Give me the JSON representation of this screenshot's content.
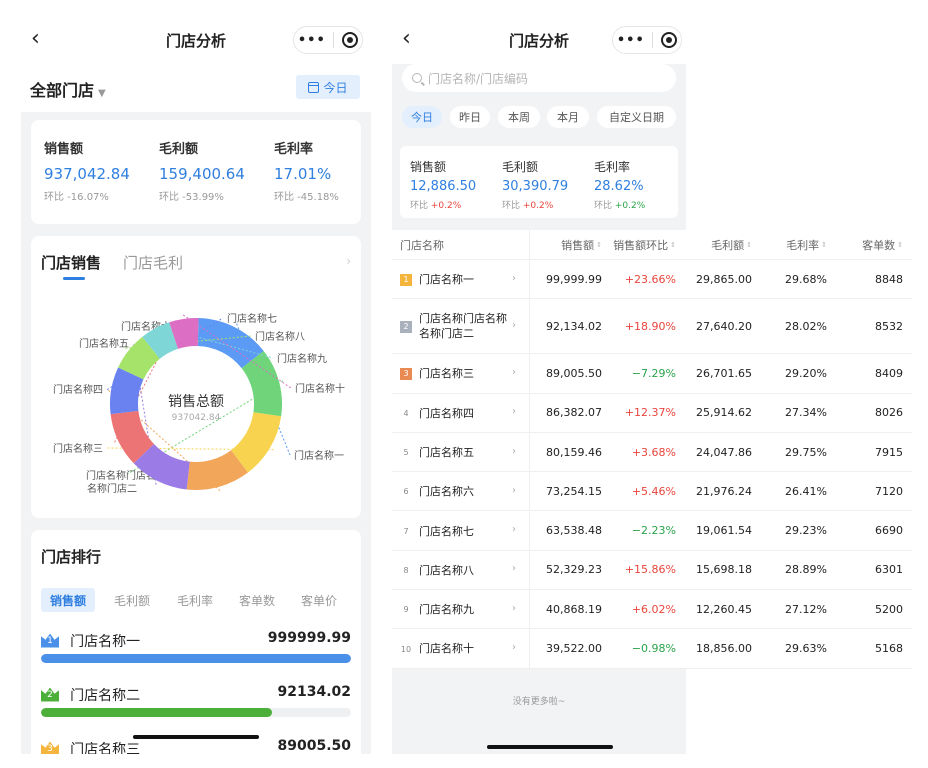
{
  "colors": {
    "accent": "#2f7fe0",
    "up": "#e8453c",
    "down": "#2aa34a",
    "bg": "#f2f3f5"
  },
  "left": {
    "nav": {
      "title": "门店分析",
      "back_icon": "chevron-left-icon",
      "more_icon": "more-dots-icon",
      "target_icon": "target-icon"
    },
    "store_selector": "全部门店",
    "date_button": "今日",
    "metrics": [
      {
        "label": "销售额",
        "value": "937,042.84",
        "compare": "环比 -16.07%"
      },
      {
        "label": "毛利额",
        "value": "159,400.64",
        "compare": "环比 -53.99%"
      },
      {
        "label": "毛利率",
        "value": "17.01%",
        "compare": "环比 -45.18%"
      }
    ],
    "sales_card": {
      "tab_active": "门店销售",
      "tab_inactive": "门店毛利",
      "arrow": "›"
    },
    "chart_data": {
      "type": "pie",
      "center_title": "销售总额",
      "center_value": "937042.84",
      "slices": [
        {
          "name": "门店名称一",
          "value": 99999.99,
          "color": "#5b9bf5"
        },
        {
          "name": "门店名称门店名称名称门店二",
          "value": 92134.02,
          "color": "#6fd47a"
        },
        {
          "name": "门店名称三",
          "value": 89005.5,
          "color": "#f7d34f"
        },
        {
          "name": "门店名称四",
          "value": 86382.07,
          "color": "#f2a65a"
        },
        {
          "name": "门店名称五",
          "value": 80159.46,
          "color": "#9b7be6"
        },
        {
          "name": "门店名称六",
          "value": 73254.15,
          "color": "#ec7474"
        },
        {
          "name": "门店名称七",
          "value": 63538.48,
          "color": "#6a82f0"
        },
        {
          "name": "门店名称八",
          "value": 52329.23,
          "color": "#a5e36a"
        },
        {
          "name": "门店名称九",
          "value": 40868.19,
          "color": "#7fd6d6"
        },
        {
          "name": "门店名称十",
          "value": 39522.0,
          "color": "#dc6ec4"
        }
      ]
    },
    "ranking": {
      "title": "门店排行",
      "tabs": [
        "销售额",
        "毛利额",
        "毛利率",
        "客单数",
        "客单价"
      ],
      "rows": [
        {
          "rank": "1",
          "name": "门店名称一",
          "value": "999999.99",
          "fraction": 1.0,
          "color": "#4a90e8",
          "crown": "#4a90e8"
        },
        {
          "rank": "2",
          "name": "门店名称二",
          "value": "92134.02",
          "fraction": 0.745,
          "color": "#4caf3a",
          "crown": "#4caf3a"
        },
        {
          "rank": "3",
          "name": "门店名称三",
          "value": "89005.50",
          "fraction": 0.72,
          "color": "#f3b53c",
          "crown": "#f3b53c"
        }
      ]
    }
  },
  "right": {
    "nav": {
      "title": "门店分析",
      "back_icon": "chevron-left-icon"
    },
    "search_placeholder": "门店名称/门店编码",
    "date_chips": [
      "今日",
      "昨日",
      "本周",
      "本月",
      "自定义日期"
    ],
    "metrics": [
      {
        "label": "销售额",
        "value": "12,886.50",
        "compare_label": "环比",
        "compare": "+0.2%",
        "dir": "up"
      },
      {
        "label": "毛利额",
        "value": "30,390.79",
        "compare_label": "环比",
        "compare": "+0.2%",
        "dir": "up"
      },
      {
        "label": "毛利率",
        "value": "28.62%",
        "compare_label": "环比",
        "compare": "+0.2%",
        "dir": "down"
      }
    ],
    "table": {
      "headers": [
        "门店名称",
        "销售额",
        "销售额环比",
        "毛利额",
        "毛利率",
        "客单数"
      ],
      "sort_icon": "⇕",
      "rows": [
        {
          "rank": "1",
          "name": "门店名称一",
          "sales": "99,999.99",
          "sales_cmp": "+23.66%",
          "dir": "up",
          "gross": "29,865.00",
          "rate": "29.68%",
          "orders": "8848"
        },
        {
          "rank": "2",
          "name": "门店名称门店名称名称门店二",
          "sales": "92,134.02",
          "sales_cmp": "+18.90%",
          "dir": "up",
          "gross": "27,640.20",
          "rate": "28.02%",
          "orders": "8532"
        },
        {
          "rank": "3",
          "name": "门店名称三",
          "sales": "89,005.50",
          "sales_cmp": "−7.29%",
          "dir": "down",
          "gross": "26,701.65",
          "rate": "29.20%",
          "orders": "8409"
        },
        {
          "rank": "4",
          "name": "门店名称四",
          "sales": "86,382.07",
          "sales_cmp": "+12.37%",
          "dir": "up",
          "gross": "25,914.62",
          "rate": "27.34%",
          "orders": "8026"
        },
        {
          "rank": "5",
          "name": "门店名称五",
          "sales": "80,159.46",
          "sales_cmp": "+3.68%",
          "dir": "up",
          "gross": "24,047.86",
          "rate": "29.75%",
          "orders": "7915"
        },
        {
          "rank": "6",
          "name": "门店名称六",
          "sales": "73,254.15",
          "sales_cmp": "+5.46%",
          "dir": "up",
          "gross": "21,976.24",
          "rate": "26.41%",
          "orders": "7120"
        },
        {
          "rank": "7",
          "name": "门店名称七",
          "sales": "63,538.48",
          "sales_cmp": "−2.23%",
          "dir": "down",
          "gross": "19,061.54",
          "rate": "29.23%",
          "orders": "6690"
        },
        {
          "rank": "8",
          "name": "门店名称八",
          "sales": "52,329.23",
          "sales_cmp": "+15.86%",
          "dir": "up",
          "gross": "15,698.18",
          "rate": "28.89%",
          "orders": "6301"
        },
        {
          "rank": "9",
          "name": "门店名称九",
          "sales": "40,868.19",
          "sales_cmp": "+6.02%",
          "dir": "up",
          "gross": "12,260.45",
          "rate": "27.12%",
          "orders": "5200"
        },
        {
          "rank": "10",
          "name": "门店名称十",
          "sales": "39,522.00",
          "sales_cmp": "−0.98%",
          "dir": "down",
          "gross": "18,856.00",
          "rate": "29.63%",
          "orders": "5168"
        }
      ]
    },
    "footer": "没有更多啦~"
  }
}
